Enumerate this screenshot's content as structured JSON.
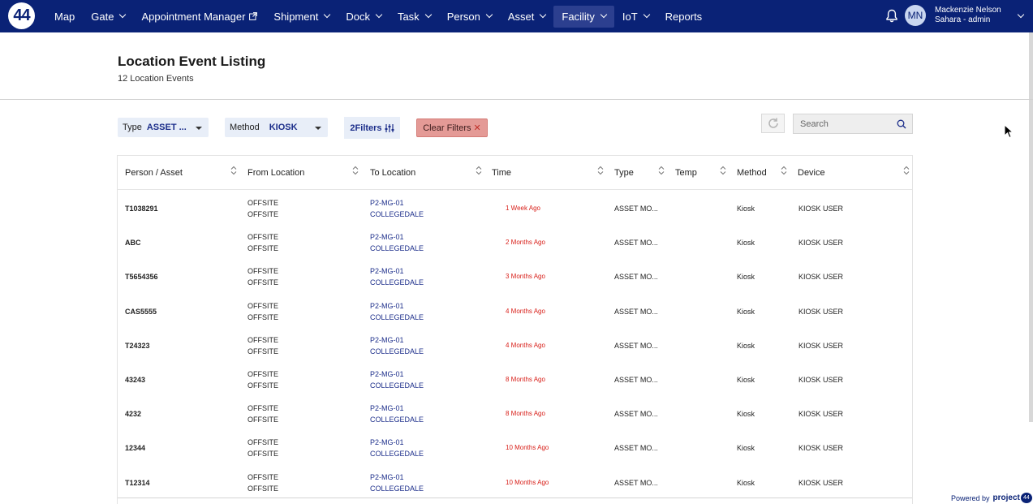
{
  "nav": {
    "logo": "44",
    "items": [
      {
        "label": "Map",
        "dropdown": false,
        "external": false,
        "active": false
      },
      {
        "label": "Gate",
        "dropdown": true,
        "external": false,
        "active": false
      },
      {
        "label": "Appointment Manager",
        "dropdown": false,
        "external": true,
        "active": false
      },
      {
        "label": "Shipment",
        "dropdown": true,
        "external": false,
        "active": false
      },
      {
        "label": "Dock",
        "dropdown": true,
        "external": false,
        "active": false
      },
      {
        "label": "Task",
        "dropdown": true,
        "external": false,
        "active": false
      },
      {
        "label": "Person",
        "dropdown": true,
        "external": false,
        "active": false
      },
      {
        "label": "Asset",
        "dropdown": true,
        "external": false,
        "active": false
      },
      {
        "label": "Facility",
        "dropdown": true,
        "external": false,
        "active": true
      },
      {
        "label": "IoT",
        "dropdown": true,
        "external": false,
        "active": false
      },
      {
        "label": "Reports",
        "dropdown": false,
        "external": false,
        "active": false
      }
    ],
    "user_initials": "MN",
    "user_name": "Mackenzie Nelson",
    "user_role": "Sahara - admin"
  },
  "header": {
    "title": "Location Event Listing",
    "subtitle": "12 Location Events"
  },
  "filters": {
    "type_label": "Type",
    "type_value": "ASSET ...",
    "method_label": "Method",
    "method_value": "KIOSK",
    "filters_button": "2Filters",
    "clear_button": "Clear Filters",
    "search_placeholder": "Search"
  },
  "table": {
    "columns": [
      "Person / Asset",
      "From Location",
      "To Location",
      "Time",
      "Type",
      "Temp",
      "Method",
      "Device"
    ],
    "rows": [
      {
        "person": "T1038291",
        "from1": "OFFSITE",
        "from2": "OFFSITE",
        "to1": "P2-MG-01",
        "to2": "COLLEGEDALE",
        "time": "1 Week Ago",
        "type": "ASSET MO...",
        "temp": "",
        "method": "Kiosk",
        "device": "KIOSK USER"
      },
      {
        "person": "ABC",
        "from1": "OFFSITE",
        "from2": "OFFSITE",
        "to1": "P2-MG-01",
        "to2": "COLLEGEDALE",
        "time": "2 Months Ago",
        "type": "ASSET MO...",
        "temp": "",
        "method": "Kiosk",
        "device": "KIOSK USER"
      },
      {
        "person": "T5654356",
        "from1": "OFFSITE",
        "from2": "OFFSITE",
        "to1": "P2-MG-01",
        "to2": "COLLEGEDALE",
        "time": "3 Months Ago",
        "type": "ASSET MO...",
        "temp": "",
        "method": "Kiosk",
        "device": "KIOSK USER"
      },
      {
        "person": "CAS5555",
        "from1": "OFFSITE",
        "from2": "OFFSITE",
        "to1": "P2-MG-01",
        "to2": "COLLEGEDALE",
        "time": "4 Months Ago",
        "type": "ASSET MO...",
        "temp": "",
        "method": "Kiosk",
        "device": "KIOSK USER"
      },
      {
        "person": "T24323",
        "from1": "OFFSITE",
        "from2": "OFFSITE",
        "to1": "P2-MG-01",
        "to2": "COLLEGEDALE",
        "time": "4 Months Ago",
        "type": "ASSET MO...",
        "temp": "",
        "method": "Kiosk",
        "device": "KIOSK USER"
      },
      {
        "person": "43243",
        "from1": "OFFSITE",
        "from2": "OFFSITE",
        "to1": "P2-MG-01",
        "to2": "COLLEGEDALE",
        "time": "8 Months Ago",
        "type": "ASSET MO...",
        "temp": "",
        "method": "Kiosk",
        "device": "KIOSK USER"
      },
      {
        "person": "4232",
        "from1": "OFFSITE",
        "from2": "OFFSITE",
        "to1": "P2-MG-01",
        "to2": "COLLEGEDALE",
        "time": "8 Months Ago",
        "type": "ASSET MO...",
        "temp": "",
        "method": "Kiosk",
        "device": "KIOSK USER"
      },
      {
        "person": "12344",
        "from1": "OFFSITE",
        "from2": "OFFSITE",
        "to1": "P2-MG-01",
        "to2": "COLLEGEDALE",
        "time": "10 Months Ago",
        "type": "ASSET MO...",
        "temp": "",
        "method": "Kiosk",
        "device": "KIOSK USER"
      },
      {
        "person": "T12314",
        "from1": "OFFSITE",
        "from2": "OFFSITE",
        "to1": "P2-MG-01",
        "to2": "COLLEGEDALE",
        "time": "10 Months Ago",
        "type": "ASSET MO...",
        "temp": "",
        "method": "Kiosk",
        "device": "KIOSK USER"
      }
    ]
  },
  "footer": {
    "powered_by": "Powered by",
    "brand": "project",
    "brand_mark": "44"
  },
  "colors": {
    "nav_bg": "#0a2276",
    "link": "#1b2d8a",
    "time": "#d8201a",
    "clear_bg": "#e49a96"
  }
}
